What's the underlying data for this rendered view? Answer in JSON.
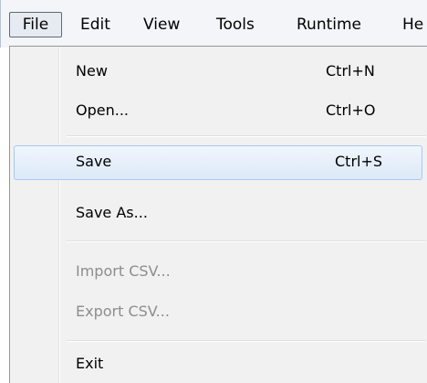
{
  "menubar": {
    "items": [
      {
        "label": "File"
      },
      {
        "label": "Edit"
      },
      {
        "label": "View"
      },
      {
        "label": "Tools"
      },
      {
        "label": "Runtime"
      },
      {
        "label": "He"
      }
    ],
    "active_item": "File"
  },
  "file_menu": {
    "items": [
      {
        "label": "New",
        "shortcut": "Ctrl+N",
        "enabled": true,
        "highlighted": false
      },
      {
        "label": "Open...",
        "shortcut": "Ctrl+O",
        "enabled": true,
        "highlighted": false
      },
      {
        "label": "Save",
        "shortcut": "Ctrl+S",
        "enabled": true,
        "highlighted": true
      },
      {
        "label": "Save As...",
        "shortcut": "",
        "enabled": true,
        "highlighted": false
      },
      {
        "label": "Import CSV...",
        "shortcut": "",
        "enabled": false,
        "highlighted": false
      },
      {
        "label": "Export CSV...",
        "shortcut": "",
        "enabled": false,
        "highlighted": false
      },
      {
        "label": "Exit",
        "shortcut": "",
        "enabled": true,
        "highlighted": false
      }
    ]
  },
  "colors": {
    "highlight_border": "#a8c8ee",
    "highlight_fill": "#dce9f8",
    "disabled_text": "#8d8d8d",
    "menu_background": "#f1f1f1"
  }
}
